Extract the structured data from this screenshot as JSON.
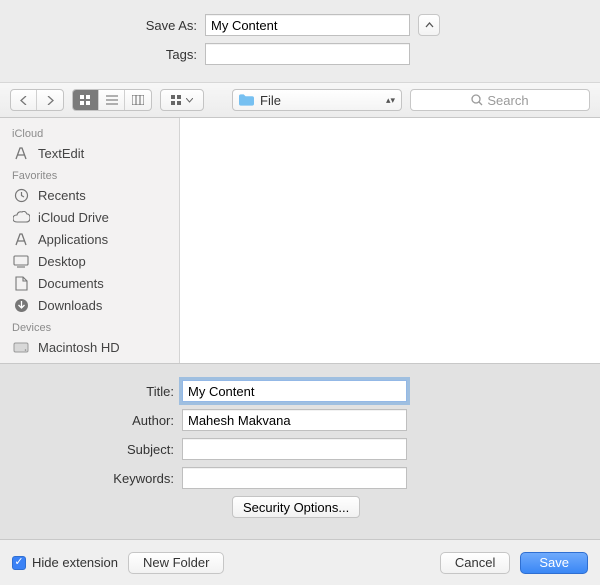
{
  "top": {
    "save_as_label": "Save As:",
    "save_as_value": "My Content",
    "tags_label": "Tags:",
    "tags_value": ""
  },
  "toolbar": {
    "location_label": "File",
    "search_placeholder": "Search"
  },
  "sidebar": {
    "groups": [
      {
        "heading": "iCloud",
        "items": [
          {
            "label": "TextEdit"
          }
        ]
      },
      {
        "heading": "Favorites",
        "items": [
          {
            "label": "Recents"
          },
          {
            "label": "iCloud Drive"
          },
          {
            "label": "Applications"
          },
          {
            "label": "Desktop"
          },
          {
            "label": "Documents"
          },
          {
            "label": "Downloads"
          }
        ]
      },
      {
        "heading": "Devices",
        "items": [
          {
            "label": "Macintosh HD"
          }
        ]
      }
    ]
  },
  "meta": {
    "title_label": "Title:",
    "title_value": "My Content",
    "author_label": "Author:",
    "author_value": "Mahesh Makvana",
    "subject_label": "Subject:",
    "subject_value": "",
    "keywords_label": "Keywords:",
    "keywords_value": "",
    "security_label": "Security Options..."
  },
  "footer": {
    "hide_ext_label": "Hide extension",
    "hide_ext_checked": true,
    "new_folder_label": "New Folder",
    "cancel_label": "Cancel",
    "save_label": "Save"
  }
}
